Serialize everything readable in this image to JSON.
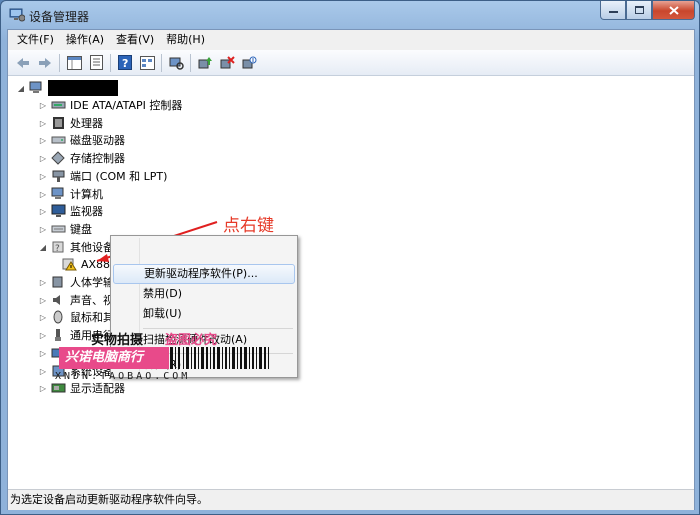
{
  "window": {
    "title": "设备管理器",
    "buttons": [
      "minimize",
      "maximize",
      "close"
    ]
  },
  "menubar": [
    "文件(F)",
    "操作(A)",
    "查看(V)",
    "帮助(H)"
  ],
  "toolbar": [
    "back-icon",
    "forward-icon",
    "properties-grid-icon",
    "properties-icon",
    "help-icon",
    "view-icon",
    "scan-hardware-icon",
    "update-driver-icon",
    "uninstall-icon",
    "disable-icon"
  ],
  "tree": {
    "root_label": "",
    "items": [
      {
        "label": "IDE ATA/ATAPI 控制器",
        "icon": "ide-controller-icon"
      },
      {
        "label": "处理器",
        "icon": "processor-icon"
      },
      {
        "label": "磁盘驱动器",
        "icon": "disk-drive-icon"
      },
      {
        "label": "存储控制器",
        "icon": "storage-controller-icon"
      },
      {
        "label": "端口 (COM 和 LPT)",
        "icon": "port-icon"
      },
      {
        "label": "计算机",
        "icon": "computer-icon"
      },
      {
        "label": "监视器",
        "icon": "monitor-icon"
      },
      {
        "label": "键盘",
        "icon": "keyboard-icon"
      },
      {
        "label": "其他设备",
        "icon": "other-devices-icon"
      },
      {
        "label": "AX88179",
        "icon": "warning-device-icon"
      },
      {
        "label": "人体学输入",
        "icon": "hid-icon"
      },
      {
        "label": "声音、视频",
        "icon": "sound-icon"
      },
      {
        "label": "鼠标和其它",
        "icon": "mouse-icon"
      },
      {
        "label": "通用串行总",
        "icon": "usb-icon"
      },
      {
        "label": "网络适配器",
        "icon": "network-adapter-icon"
      },
      {
        "label": "系统设备",
        "icon": "system-device-icon"
      },
      {
        "label": "显示适配器",
        "icon": "display-adapter-icon"
      }
    ]
  },
  "context_menu": {
    "items": [
      "更新驱动程序软件(P)...",
      "禁用(D)",
      "卸载(U)",
      "扫描检测硬件改动(A)",
      "属性(R)"
    ]
  },
  "annotation": "点右键",
  "watermark": {
    "line1": "实物拍摄",
    "line2": "盗图必究",
    "brand": "兴诺电脑商行",
    "url": "XNDN.TAOBAO.COM"
  },
  "statusbar": "为选定设备启动更新驱动程序软件向导。",
  "colors": {
    "annotation_red": "#e63a28",
    "highlight_border": "#e02020",
    "watermark_pink": "#e84a8a"
  }
}
